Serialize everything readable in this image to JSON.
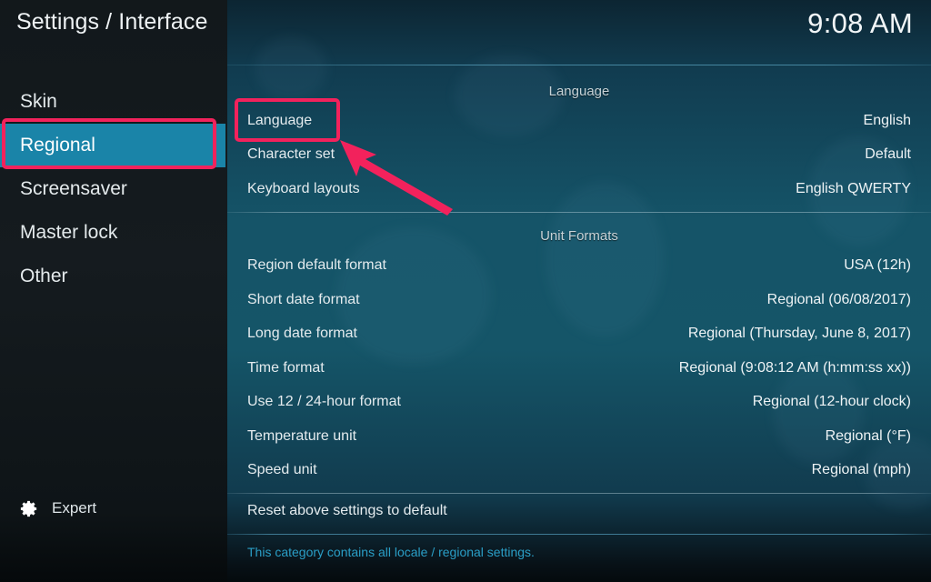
{
  "window": {
    "title": "Settings / Interface",
    "clock": "9:08 AM"
  },
  "sidebar": {
    "items": [
      {
        "label": "Skin",
        "selected": false
      },
      {
        "label": "Regional",
        "selected": true
      },
      {
        "label": "Screensaver",
        "selected": false
      },
      {
        "label": "Master lock",
        "selected": false
      },
      {
        "label": "Other",
        "selected": false
      }
    ],
    "footer": {
      "icon": "gear-icon",
      "label": "Expert"
    }
  },
  "main": {
    "sections": [
      {
        "heading": "Language",
        "rows": [
          {
            "label": "Language",
            "value": "English",
            "highlighted": true
          },
          {
            "label": "Character set",
            "value": "Default",
            "highlighted": false
          },
          {
            "label": "Keyboard layouts",
            "value": "English QWERTY",
            "highlighted": false
          }
        ]
      },
      {
        "heading": "Unit Formats",
        "rows": [
          {
            "label": "Region default format",
            "value": "USA (12h)",
            "highlighted": false
          },
          {
            "label": "Short date format",
            "value": "Regional (06/08/2017)",
            "highlighted": false
          },
          {
            "label": "Long date format",
            "value": "Regional (Thursday, June 8, 2017)",
            "highlighted": false
          },
          {
            "label": "Time format",
            "value": "Regional (9:08:12 AM (h:mm:ss xx))",
            "highlighted": false
          },
          {
            "label": "Use 12 / 24-hour format",
            "value": "Regional (12-hour clock)",
            "highlighted": false
          },
          {
            "label": "Temperature unit",
            "value": "Regional (°F)",
            "highlighted": false
          },
          {
            "label": "Speed unit",
            "value": "Regional (mph)",
            "highlighted": false
          }
        ]
      }
    ],
    "reset_row": {
      "label": "Reset above settings to default",
      "value": ""
    },
    "help_text": "This category contains all locale / regional settings."
  },
  "annotations": {
    "color": "#f2225c",
    "arrow": {
      "name": "pointer-arrow",
      "points_to": "Language"
    },
    "boxes": [
      {
        "name": "highlight-regional",
        "target": "Regional"
      },
      {
        "name": "highlight-language",
        "target": "Language"
      }
    ]
  },
  "colors": {
    "sidebar_bg": "#14191c",
    "main_bg": "#14506b",
    "selected_item": "#1a84a8",
    "help_text": "#2a9ec6",
    "annotation": "#f2225c",
    "text_primary": "#e8eef0"
  }
}
